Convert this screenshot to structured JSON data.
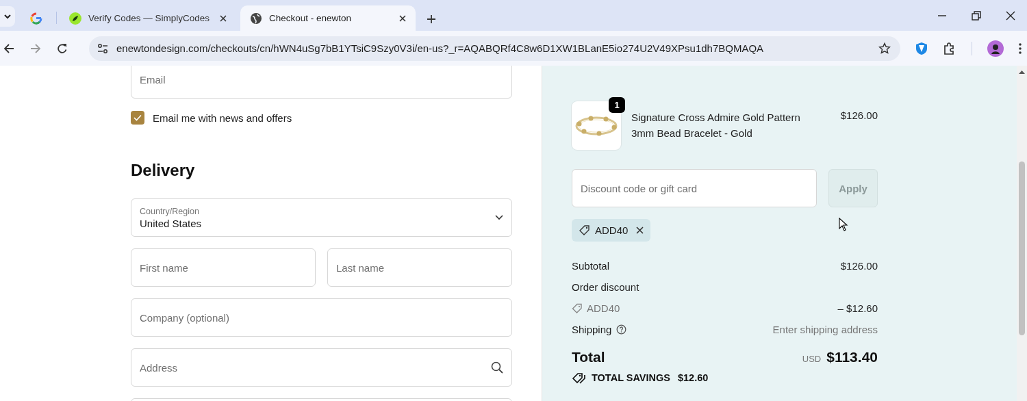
{
  "browser": {
    "tabs": [
      {
        "kind": "google",
        "selected": false
      },
      {
        "kind": "app",
        "title": "Verify Codes — SimplyCodes",
        "selected": false
      },
      {
        "kind": "web",
        "title": "Checkout - enewton",
        "selected": true
      }
    ],
    "url": "enewtondesign.com/checkouts/cn/hWN4uSg7bB1YTsiC9Szy0V3i/en-us?_r=AQABQRf4C8w6D1XW1BLanE5io274U2V49XPsu1dh7BQMAQA"
  },
  "form": {
    "email": {
      "placeholder": "Email"
    },
    "newsletter": {
      "label": "Email me with news and offers",
      "checked": true
    },
    "heading": "Delivery",
    "country": {
      "label": "Country/Region",
      "value": "United States"
    },
    "rows": [
      [
        {
          "kind": "plain",
          "placeholder": "First name"
        },
        {
          "kind": "plain",
          "placeholder": "Last name"
        }
      ],
      [
        {
          "kind": "plain",
          "placeholder": "Company (optional)"
        }
      ],
      [
        {
          "kind": "search",
          "placeholder": "Address"
        }
      ],
      [
        {
          "kind": "blank"
        }
      ]
    ]
  },
  "summary": {
    "item": {
      "quantity": "1",
      "name": "Signature Cross Admire Gold Pattern 3mm Bead Bracelet - Gold",
      "price": "$126.00"
    },
    "discount": {
      "placeholder": "Discount code or gift card",
      "button": "Apply",
      "disabled": true
    },
    "applied_codes": [
      {
        "code": "ADD40"
      }
    ],
    "lines": [
      {
        "kind": "plain",
        "label": "Subtotal",
        "value": "$126.00"
      },
      {
        "kind": "plain",
        "label": "Order discount"
      },
      {
        "kind": "code",
        "label": "ADD40",
        "value": "– $12.60"
      },
      {
        "kind": "help",
        "label": "Shipping",
        "value": "Enter shipping address"
      }
    ],
    "total": {
      "label": "Total",
      "currency": "USD",
      "amount": "$113.40"
    },
    "savings": {
      "label": "TOTAL SAVINGS",
      "amount": "$12.60"
    }
  }
}
